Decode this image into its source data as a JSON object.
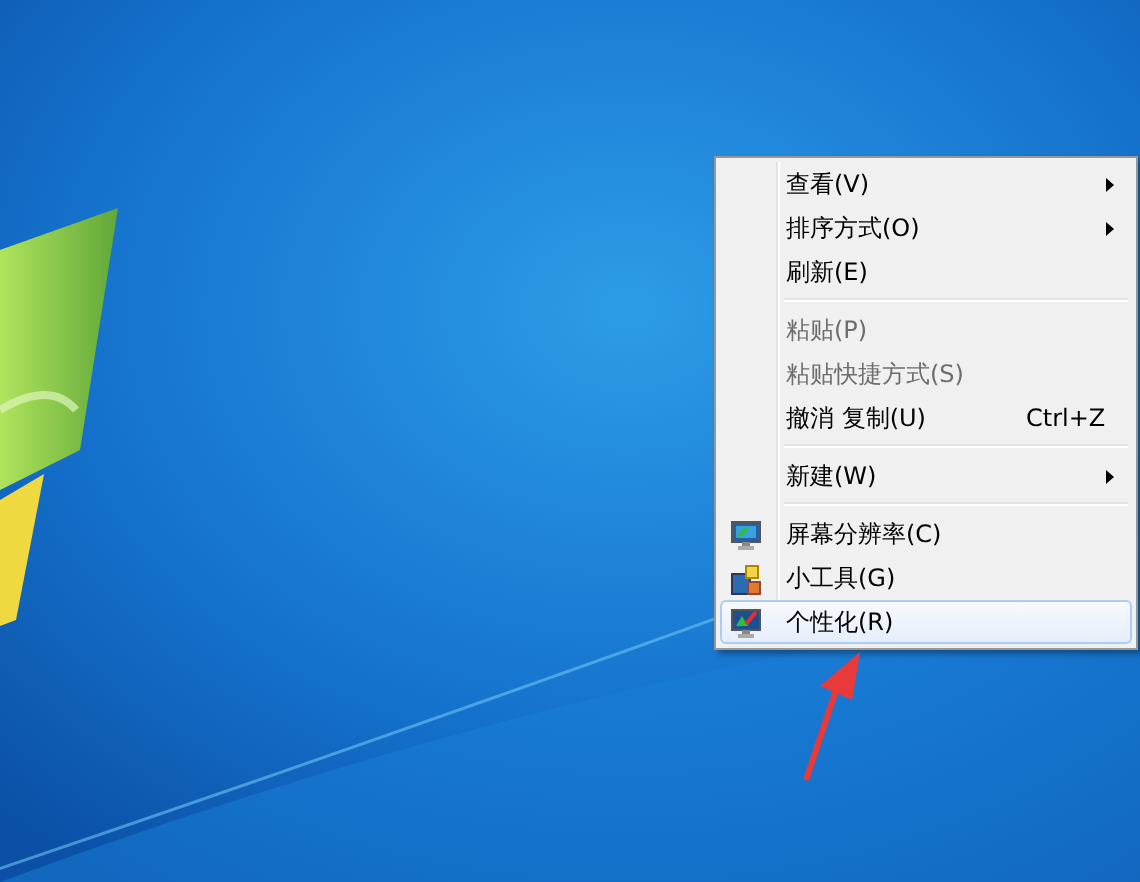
{
  "context_menu": {
    "items": [
      {
        "kind": "plain",
        "label": "查看(V)",
        "has_submenu": true,
        "disabled": false,
        "selected": false
      },
      {
        "kind": "plain",
        "label": "排序方式(O)",
        "has_submenu": true,
        "disabled": false,
        "selected": false
      },
      {
        "kind": "plain",
        "label": "刷新(E)",
        "has_submenu": false,
        "disabled": false,
        "selected": false
      },
      {
        "kind": "separator"
      },
      {
        "kind": "plain",
        "label": "粘贴(P)",
        "has_submenu": false,
        "disabled": true,
        "selected": false
      },
      {
        "kind": "plain",
        "label": "粘贴快捷方式(S)",
        "has_submenu": false,
        "disabled": true,
        "selected": false
      },
      {
        "kind": "plain",
        "label": "撤消 复制(U)",
        "shortcut": "Ctrl+Z",
        "has_submenu": false,
        "disabled": false,
        "selected": false
      },
      {
        "kind": "separator"
      },
      {
        "kind": "plain",
        "label": "新建(W)",
        "has_submenu": true,
        "disabled": false,
        "selected": false
      },
      {
        "kind": "separator"
      },
      {
        "kind": "icon",
        "label": "屏幕分辨率(C)",
        "has_submenu": false,
        "disabled": false,
        "selected": false
      },
      {
        "kind": "icon",
        "label": "小工具(G)",
        "has_submenu": false,
        "disabled": false,
        "selected": false
      },
      {
        "kind": "icon",
        "label": "个性化(R)",
        "has_submenu": false,
        "disabled": false,
        "selected": true
      }
    ]
  }
}
